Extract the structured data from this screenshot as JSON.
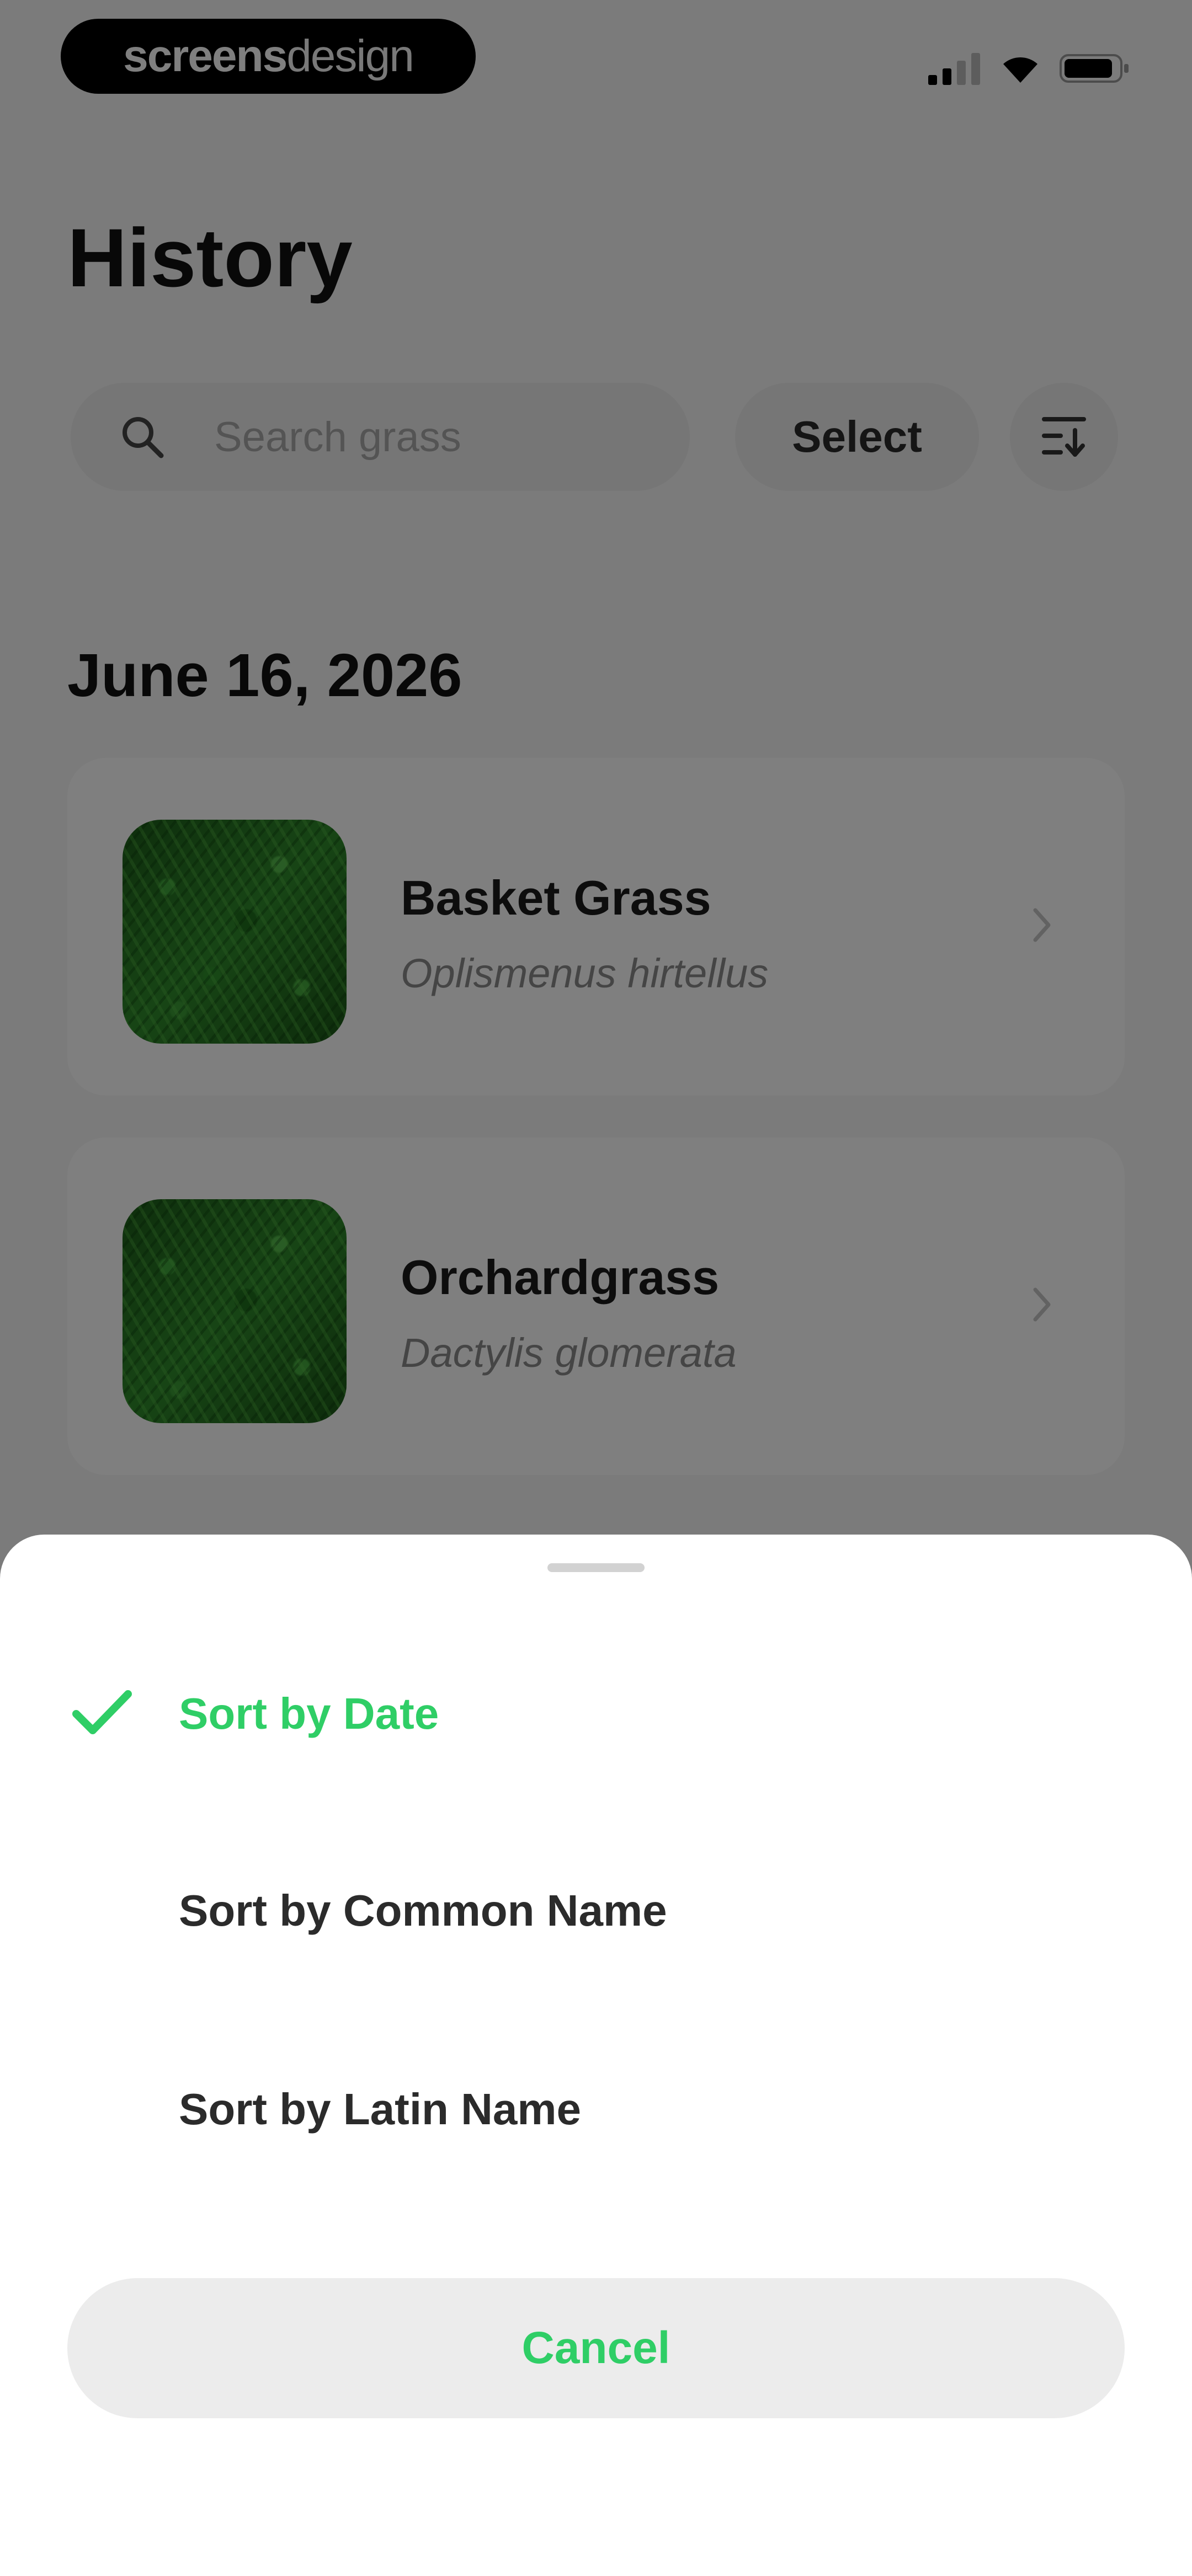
{
  "brand": {
    "bold": "screens",
    "light": "design"
  },
  "header": {
    "title": "History",
    "search_placeholder": "Search grass",
    "select_label": "Select"
  },
  "history": {
    "date": "June 16, 2026",
    "items": [
      {
        "common_name": "Basket Grass",
        "latin_name": "Oplismenus hirtellus"
      },
      {
        "common_name": "Orchardgrass",
        "latin_name": "Dactylis glomerata"
      }
    ]
  },
  "sort_sheet": {
    "options": [
      {
        "label": "Sort by Date",
        "selected": true
      },
      {
        "label": "Sort by Common Name",
        "selected": false
      },
      {
        "label": "Sort by Latin Name",
        "selected": false
      }
    ],
    "cancel_label": "Cancel"
  },
  "colors": {
    "accent": "#2fce66",
    "overlay": "rgba(0,0,0,0.5)"
  },
  "icons": [
    "signal-icon",
    "wifi-icon",
    "battery-icon",
    "search-icon",
    "sort-icon",
    "chevron-right-icon",
    "checkmark-icon"
  ]
}
